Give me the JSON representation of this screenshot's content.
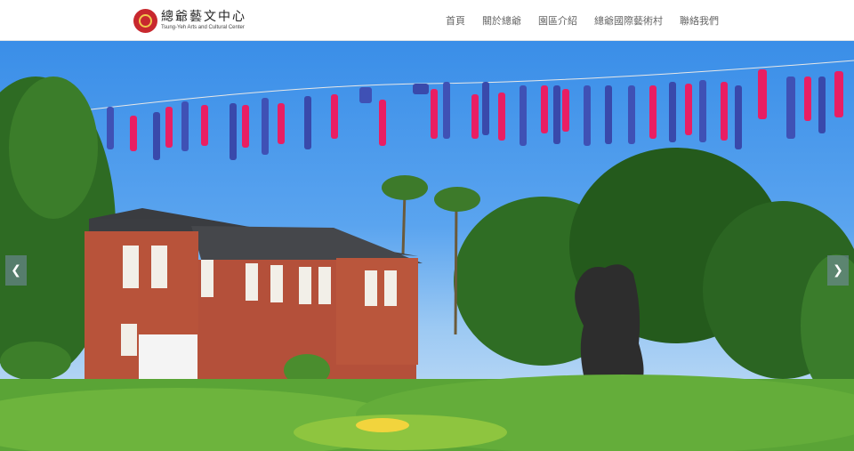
{
  "site": {
    "logo_zh": "總爺藝文中心",
    "logo_en": "Tsung-Yeh Arts and Cultural Center"
  },
  "nav": {
    "items": [
      {
        "label": "首頁"
      },
      {
        "label": "關於總爺"
      },
      {
        "label": "園區介紹"
      },
      {
        "label": "總爺國際藝術村"
      },
      {
        "label": "聯絡我們"
      }
    ]
  },
  "slider": {
    "prev_icon": "chevron-left-icon",
    "next_icon": "chevron-right-icon"
  },
  "colors": {
    "nav_text": "#666666",
    "logo_red": "#c8282e",
    "sky": "#4a98ec",
    "brick": "#b8533a"
  }
}
